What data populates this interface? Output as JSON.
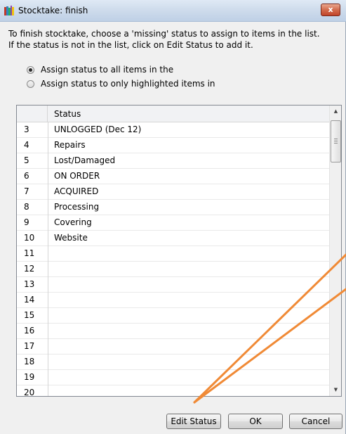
{
  "window": {
    "title": "Stocktake: finish",
    "close_label": "x"
  },
  "instructions": [
    "To finish stocktake, choose a 'missing' status to assign to items in the list.",
    "If the status is not in the list, click on Edit Status to add it."
  ],
  "options": [
    {
      "label": "Assign status to all items in the",
      "checked": true
    },
    {
      "label": "Assign status to only highlighted items in",
      "checked": false
    }
  ],
  "grid": {
    "header": "Status",
    "rows": [
      {
        "num": "3",
        "status": "UNLOGGED (Dec 12)"
      },
      {
        "num": "4",
        "status": "Repairs"
      },
      {
        "num": "5",
        "status": "Lost/Damaged"
      },
      {
        "num": "6",
        "status": "ON ORDER"
      },
      {
        "num": "7",
        "status": "ACQUIRED"
      },
      {
        "num": "8",
        "status": "Processing"
      },
      {
        "num": "9",
        "status": "Covering"
      },
      {
        "num": "10",
        "status": "Website"
      },
      {
        "num": "11",
        "status": ""
      },
      {
        "num": "12",
        "status": ""
      },
      {
        "num": "13",
        "status": ""
      },
      {
        "num": "14",
        "status": ""
      },
      {
        "num": "15",
        "status": ""
      },
      {
        "num": "16",
        "status": ""
      },
      {
        "num": "17",
        "status": ""
      },
      {
        "num": "18",
        "status": ""
      },
      {
        "num": "19",
        "status": ""
      },
      {
        "num": "20",
        "status": ""
      }
    ]
  },
  "buttons": {
    "edit_status": "Edit Status",
    "ok": "OK",
    "cancel": "Cancel"
  },
  "colors": {
    "annotation": "#f08a36",
    "titlebar": "#cfdcec",
    "close": "#c0442a"
  }
}
